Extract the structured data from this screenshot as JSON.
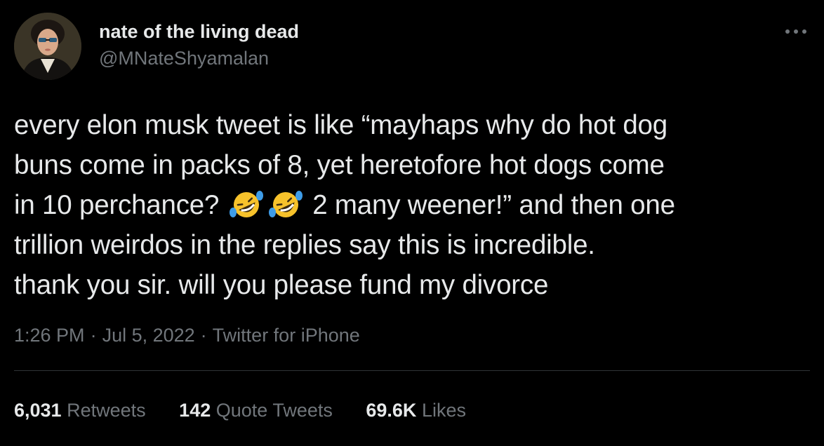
{
  "author": {
    "display_name": "nate of the living dead",
    "handle": "@MNateShyamalan"
  },
  "icons": {
    "avatar": "painted-portrait-avatar",
    "more": "more-options-icon",
    "emoji": "rolling-on-the-floor-laughing-emoji"
  },
  "tweet": {
    "lines": [
      "every elon musk tweet is like “mayhaps why do hot dog",
      "buns come in packs of 8, yet heretofore hot dogs come",
      "in 10 perchance?",
      "2 many weener!” and then one",
      "trillion weirdos in the replies say this is incredible.",
      "thank you sir. will you please fund my divorce"
    ]
  },
  "meta": {
    "time": "1:26 PM",
    "separator": "·",
    "date": "Jul 5, 2022",
    "source": "Twitter for iPhone"
  },
  "stats": {
    "retweets": {
      "count": "6,031",
      "label": "Retweets"
    },
    "quote_tweets": {
      "count": "142",
      "label": "Quote Tweets"
    },
    "likes": {
      "count": "69.6K",
      "label": "Likes"
    }
  },
  "colors": {
    "background": "#000000",
    "primary_text": "#e7e9ea",
    "secondary_text": "#71767b",
    "divider": "#2f3336",
    "emoji_face": "#f7c22b",
    "emoji_tears": "#3e9ce8"
  }
}
